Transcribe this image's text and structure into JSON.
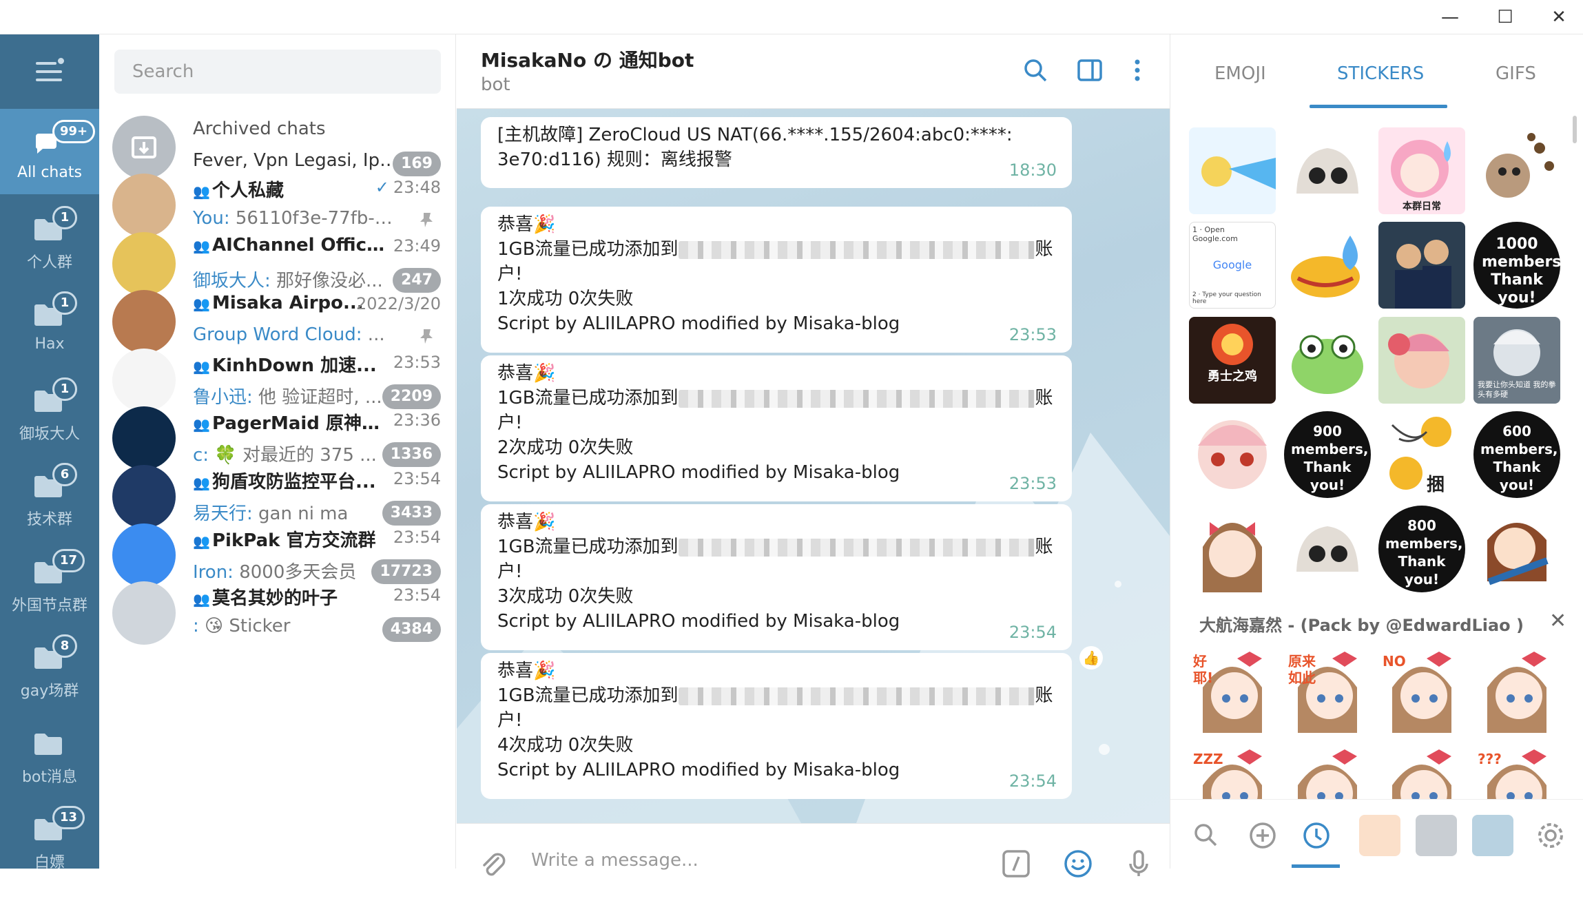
{
  "window": {
    "minimize": "—",
    "maximize": "☐",
    "close": "✕"
  },
  "folders": [
    {
      "label": "All chats",
      "badge": "99+",
      "active": true
    },
    {
      "label": "个人群",
      "badge": "1"
    },
    {
      "label": "Hax",
      "badge": "1"
    },
    {
      "label": "御坂大人",
      "badge": "1"
    },
    {
      "label": "技术群",
      "badge": "6"
    },
    {
      "label": "外国节点群",
      "badge": "17"
    },
    {
      "label": "gay场群",
      "badge": "8"
    },
    {
      "label": "bot消息",
      "badge": ""
    },
    {
      "label": "白嫖",
      "badge": "13"
    }
  ],
  "search": {
    "placeholder": "Search"
  },
  "archived": {
    "title": "Archived chats",
    "preview": "Fever, Vpn Legasi, Iph...",
    "badge": "169"
  },
  "chats": [
    {
      "name": "个人私藏",
      "time": "23:48",
      "sender": "You:",
      "preview": " 56110f3e-77fb-4e5...",
      "badge": "",
      "pinned": true,
      "check": "✓",
      "avatar_color": "#d9b48c"
    },
    {
      "name": "AIChannel Official...",
      "time": "23:49",
      "sender": "御坂大人:",
      "preview": " 那好像没必...",
      "badge": "247",
      "avatar_color": "#e6c35a"
    },
    {
      "name": "Misaka Airpo...",
      "time": "2022/3/20",
      "sender": "Group Word Cloud:",
      "preview": " ...",
      "badge": "",
      "pinned": true,
      "avatar_color": "#b87a50"
    },
    {
      "name": "KinhDown 加速...",
      "time": "23:53",
      "sender": "鲁小迅:",
      "preview": " 他 验证超时, ...",
      "badge": "2209",
      "avatar_color": "#f5f5f5"
    },
    {
      "name": "PagerMaid 原神 群...",
      "time": "23:36",
      "sender": "c:",
      "preview": " 🍀 对最近的 375 ...",
      "badge": "1336",
      "avatar_color": "#0d2a4a"
    },
    {
      "name": "狗盾攻防监控平台...",
      "time": "23:54",
      "sender": "易天行:",
      "preview": " gan ni ma",
      "badge": "3433",
      "avatar_color": "#1f3a66"
    },
    {
      "name": "PikPak 官方交流群",
      "time": "23:54",
      "sender": "Iron:",
      "preview": " 8000多天会员",
      "badge": "17723",
      "avatar_color": "#3b8cf0"
    },
    {
      "name": "莫名其妙的叶子",
      "time": "23:54",
      "sender": ":",
      "preview": " 😘 Sticker",
      "badge": "4384",
      "avatar_color": "#d0d6dc"
    }
  ],
  "header": {
    "title": "MisakaNo の 通知bot",
    "subtitle": "bot"
  },
  "messages": [
    {
      "lines": [
        "[主机故障] ZeroCloud US NAT(66.****.155/2604:abc0:****:",
        "3e70:d116) 规则：离线报警"
      ],
      "time": "18:30"
    },
    {
      "l1": "恭喜🎉",
      "l2a": "1GB流量已成功添加到",
      "l2b": "账",
      "l3": "户!",
      "l4": "1次成功 0次失败",
      "l5": "Script by ALIILAPRO modified by Misaka-blog",
      "time": "23:53"
    },
    {
      "l1": "恭喜🎉",
      "l2a": "1GB流量已成功添加到",
      "l2b": "账",
      "l3": "户!",
      "l4": "2次成功 0次失败",
      "l5": "Script by ALIILAPRO modified by Misaka-blog",
      "time": "23:53"
    },
    {
      "l1": "恭喜🎉",
      "l2a": "1GB流量已成功添加到",
      "l2b": "账",
      "l3": "户!",
      "l4": "3次成功 0次失败",
      "l5": "Script by ALIILAPRO modified by Misaka-blog",
      "time": "23:54"
    },
    {
      "l1": "恭喜🎉",
      "l2a": "1GB流量已成功添加到",
      "l2b": "账",
      "l3": "户!",
      "l4": "4次成功 0次失败",
      "l5": "Script by ALIILAPRO modified by Misaka-blog",
      "time": "23:54"
    }
  ],
  "reaction": "👍",
  "composer": {
    "placeholder": "Write a message..."
  },
  "sticker_panel": {
    "tabs": [
      "EMOJI",
      "STICKERS",
      "GIFS"
    ],
    "captions": {
      "s3": "本群日常",
      "s5a": "1 · Open Google.com",
      "s5b": "Google",
      "s5c": "2 · Type your question here",
      "s9": "勇士之鸡",
      "s12": "我要让你头知道 我的拳头有多硬",
      "s13": "1000 members, Thank you!",
      "s14": "900 members, Thank you!",
      "s15": "捆",
      "s16": "600 members, Thank you!",
      "s19": "800 members, Thank you!"
    },
    "pack_title": "大航海嘉然 - (Pack by @EdwardLiao )",
    "pack_close": "✕",
    "pack_caps": [
      "好耶!",
      "原来如此",
      "NO",
      "",
      "ZZZ",
      "",
      "",
      "???"
    ]
  }
}
